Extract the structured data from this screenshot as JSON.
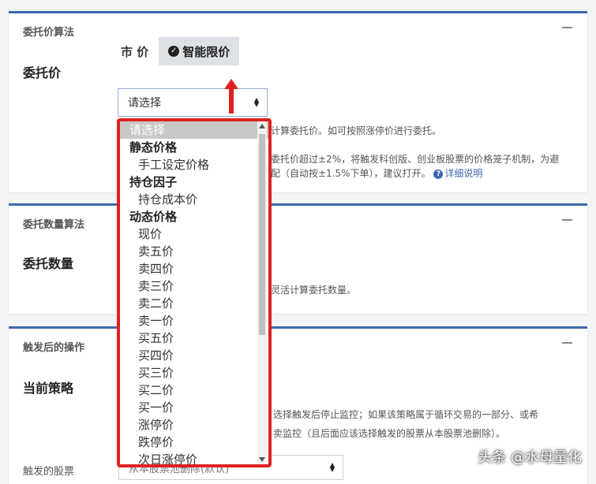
{
  "section_price": {
    "title": "委托价算法",
    "label": "委托价",
    "market_btn": "市 价",
    "smart_btn": "智能限价",
    "select_value": "请选择",
    "help_1": "计算委托价。如可按照涨停价进行委托。",
    "help_2": "委托价超过±2%，将触发科创版、创业板股票的价格笼子机制，为避",
    "help_3": "配（自动按±1.5%下单），建议打开。",
    "help_link": "详细说明"
  },
  "section_qty": {
    "title": "委托数量算法",
    "label": "委托数量",
    "help": "灵活计算委托数量。"
  },
  "section_action": {
    "title": "触发后的操作",
    "label": "当前策略",
    "help_1": "选择触发后停止监控；如果该策略属于循环交易的一部分、或希",
    "help_2": "卖监控（且后面应该选择触发的股票从本股票池删除）。",
    "trigger_label": "触发的股票",
    "trigger_value": "从本股票池删除(默认)"
  },
  "dropdown": {
    "options": [
      {
        "label": "请选择",
        "kind": "selected"
      },
      {
        "label": "静态价格",
        "kind": "group"
      },
      {
        "label": "手工设定价格",
        "kind": "child"
      },
      {
        "label": "持仓因子",
        "kind": "group"
      },
      {
        "label": "持仓成本价",
        "kind": "child"
      },
      {
        "label": "动态价格",
        "kind": "group"
      },
      {
        "label": "现价",
        "kind": "child"
      },
      {
        "label": "卖五价",
        "kind": "child"
      },
      {
        "label": "卖四价",
        "kind": "child"
      },
      {
        "label": "卖三价",
        "kind": "child"
      },
      {
        "label": "卖二价",
        "kind": "child"
      },
      {
        "label": "卖一价",
        "kind": "child"
      },
      {
        "label": "买五价",
        "kind": "child"
      },
      {
        "label": "买四价",
        "kind": "child"
      },
      {
        "label": "买三价",
        "kind": "child"
      },
      {
        "label": "买二价",
        "kind": "child"
      },
      {
        "label": "买一价",
        "kind": "child"
      },
      {
        "label": "涨停价",
        "kind": "child"
      },
      {
        "label": "跌停价",
        "kind": "child"
      },
      {
        "label": "次日涨停价",
        "kind": "child"
      }
    ]
  },
  "watermark": "头条 @水母量化",
  "colors": {
    "accent": "#3c68b0",
    "highlight": "#e02020"
  }
}
